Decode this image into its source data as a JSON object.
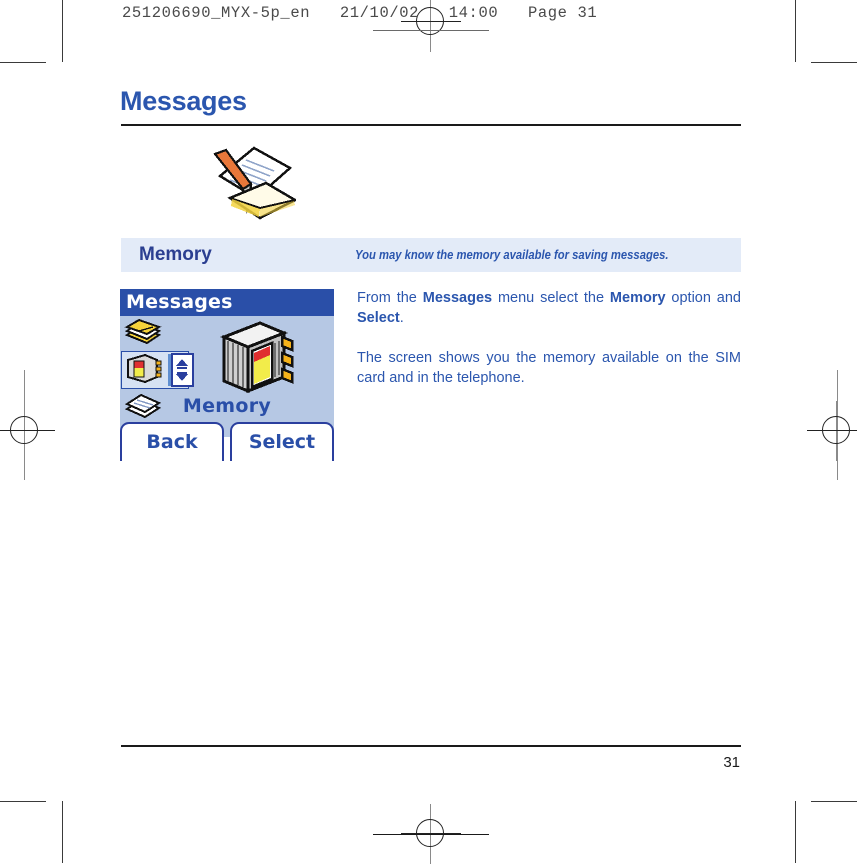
{
  "slug": {
    "text": "251206690_MYX-5p_en   21/10/02   14:00   Page 31"
  },
  "page": {
    "title": "Messages",
    "folio": "31"
  },
  "illustration": {
    "name": "note-pencil-envelope-illustration"
  },
  "section": {
    "title": "Memory",
    "subtitle": "You may know the memory available for saving messages."
  },
  "phone": {
    "titlebar": "Messages",
    "selected_label": "Memory",
    "softkeys": {
      "left": "Back",
      "right": "Select"
    },
    "icons": [
      {
        "name": "messages-stack-icon"
      },
      {
        "name": "memory-module-icon"
      },
      {
        "name": "notepad-icon"
      }
    ],
    "scroller": {
      "name": "scroll-up-down-icon"
    },
    "main_icon": {
      "name": "memory-module-large-icon"
    },
    "colors": {
      "screen_bg": "#b6c8e4",
      "titlebar_bg": "#2a4fa8",
      "accent_text": "#2a4fa8"
    }
  },
  "body": {
    "paragraph1": {
      "t1": "From the ",
      "b1": "Messages",
      "t2": " menu select the ",
      "b2": "Memory",
      "t3": " option and ",
      "b3": "Select",
      "t4": "."
    },
    "paragraph2": "The screen shows you the memory available on the SIM card and in the telephone."
  },
  "theme": {
    "brand_blue": "#2b56ae",
    "band_bg": "#e3ebf8",
    "heading_navy": "#2b3f91"
  }
}
